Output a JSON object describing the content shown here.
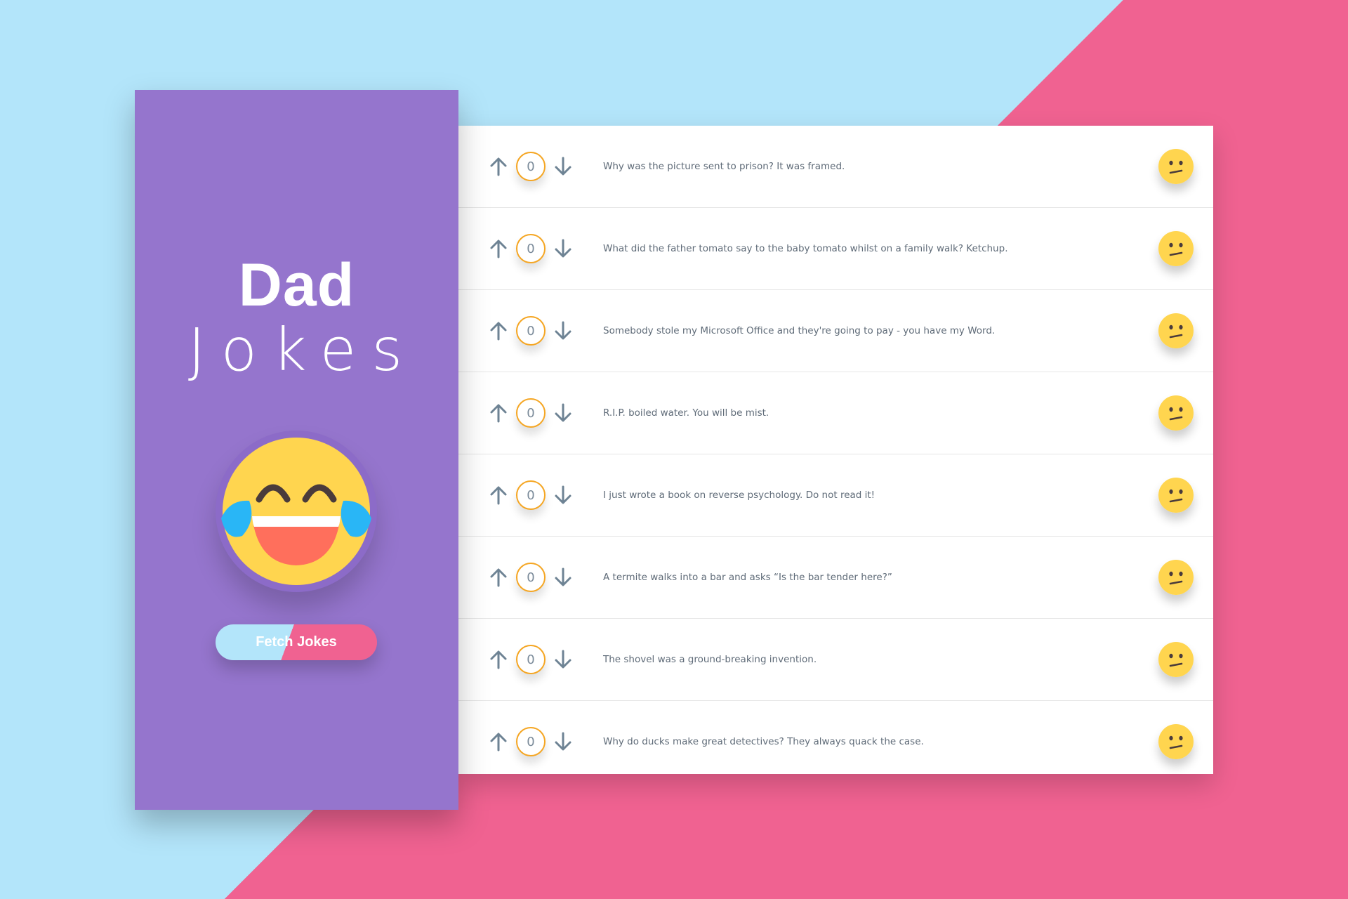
{
  "app": {
    "title_bold": "Dad",
    "title_light": "Jokes",
    "fetch_button_label": "Fetch  Jokes",
    "logo_icon": "laughing-tears-emoji"
  },
  "colors": {
    "background_blue": "#b3e5fa",
    "background_pink": "#f06291",
    "sidebar": "#9575cd",
    "vote_ring": "#f5a623",
    "emoji_yellow": "#ffd54f"
  },
  "jokes": [
    {
      "text": "Why was the picture sent to prison? It was framed.",
      "votes": "0",
      "reaction": "confused-face"
    },
    {
      "text": "What did the father tomato say to the baby tomato whilst on a family walk? Ketchup.",
      "votes": "0",
      "reaction": "confused-face"
    },
    {
      "text": "Somebody stole my Microsoft Office and they're going to pay - you have my Word.",
      "votes": "0",
      "reaction": "confused-face"
    },
    {
      "text": "R.I.P. boiled water. You will be mist.",
      "votes": "0",
      "reaction": "confused-face"
    },
    {
      "text": "I just wrote a book on reverse psychology. Do not read it!",
      "votes": "0",
      "reaction": "confused-face"
    },
    {
      "text": "A termite walks into a bar and asks “Is the bar tender here?”",
      "votes": "0",
      "reaction": "confused-face"
    },
    {
      "text": "The shovel was a ground-breaking invention.",
      "votes": "0",
      "reaction": "confused-face"
    },
    {
      "text": "Why do ducks make great detectives? They always quack the case.",
      "votes": "0",
      "reaction": "confused-face"
    }
  ]
}
